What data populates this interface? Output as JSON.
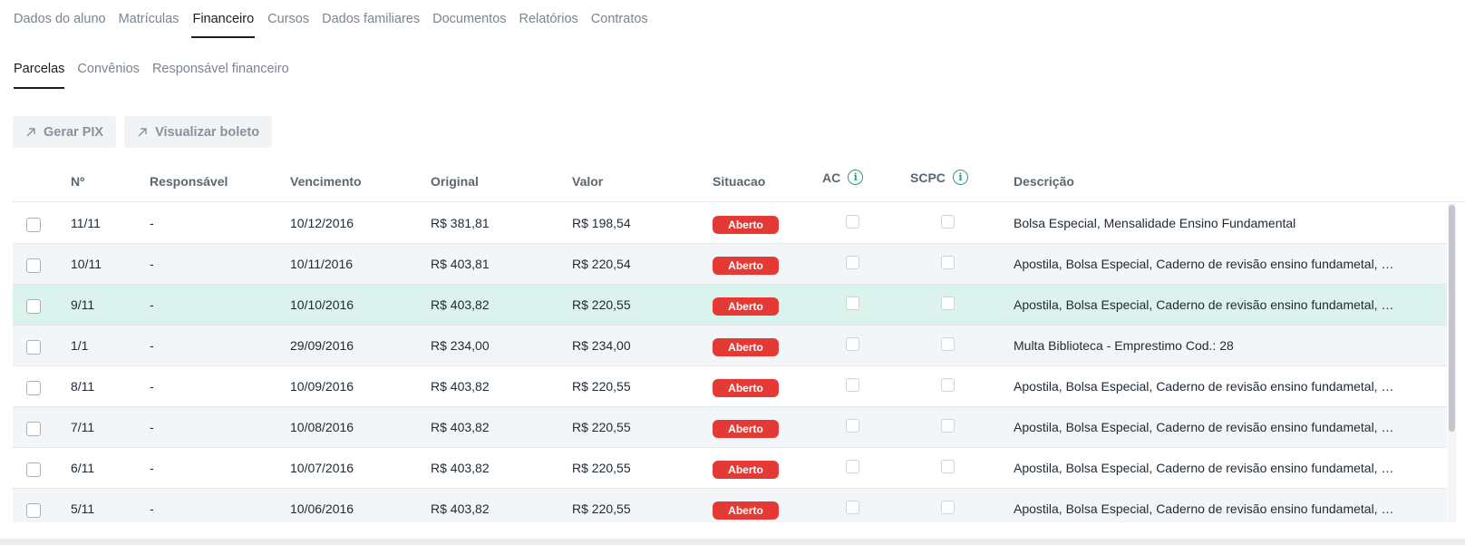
{
  "top_tabs": [
    {
      "label": "Dados do aluno"
    },
    {
      "label": "Matrículas"
    },
    {
      "label": "Financeiro",
      "active": true
    },
    {
      "label": "Cursos"
    },
    {
      "label": "Dados familiares"
    },
    {
      "label": "Documentos"
    },
    {
      "label": "Relatórios"
    },
    {
      "label": "Contratos"
    }
  ],
  "sub_tabs": [
    {
      "label": "Parcelas",
      "active": true
    },
    {
      "label": "Convênios"
    },
    {
      "label": "Responsável financeiro"
    }
  ],
  "actions": {
    "gerar_pix": "Gerar PIX",
    "visualizar_boleto": "Visualizar boleto",
    "icon": "arrow-up-right-icon"
  },
  "table": {
    "columns": {
      "numero": "Nº",
      "responsavel": "Responsável",
      "vencimento": "Vencimento",
      "original": "Original",
      "valor": "Valor",
      "situacao": "Situacao",
      "ac": "AC",
      "scpc": "SCPC",
      "descricao": "Descrição"
    },
    "rows": [
      {
        "numero": "11/11",
        "responsavel": "-",
        "vencimento": "10/12/2016",
        "original": "R$ 381,81",
        "valor": "R$ 198,54",
        "situacao": "Aberto",
        "descricao": "Bolsa Especial, Mensalidade Ensino Fundamental"
      },
      {
        "numero": "10/11",
        "responsavel": "-",
        "vencimento": "10/11/2016",
        "original": "R$ 403,81",
        "valor": "R$ 220,54",
        "situacao": "Aberto",
        "descricao": "Apostila, Bolsa Especial, Caderno de revisão ensino fundametal, Mensalidade Ensino Fundamental"
      },
      {
        "numero": "9/11",
        "responsavel": "-",
        "vencimento": "10/10/2016",
        "original": "R$ 403,82",
        "valor": "R$ 220,55",
        "situacao": "Aberto",
        "descricao": "Apostila, Bolsa Especial, Caderno de revisão ensino fundametal, Mensalidade Ensino Fundamental"
      },
      {
        "numero": "1/1",
        "responsavel": "-",
        "vencimento": "29/09/2016",
        "original": "R$ 234,00",
        "valor": "R$ 234,00",
        "situacao": "Aberto",
        "descricao": "Multa Biblioteca - Emprestimo Cod.: 28"
      },
      {
        "numero": "8/11",
        "responsavel": "-",
        "vencimento": "10/09/2016",
        "original": "R$ 403,82",
        "valor": "R$ 220,55",
        "situacao": "Aberto",
        "descricao": "Apostila, Bolsa Especial, Caderno de revisão ensino fundametal, Mensalidade Ensino Fundamental"
      },
      {
        "numero": "7/11",
        "responsavel": "-",
        "vencimento": "10/08/2016",
        "original": "R$ 403,82",
        "valor": "R$ 220,55",
        "situacao": "Aberto",
        "descricao": "Apostila, Bolsa Especial, Caderno de revisão ensino fundametal, Mensalidade Ensino Fundamental"
      },
      {
        "numero": "6/11",
        "responsavel": "-",
        "vencimento": "10/07/2016",
        "original": "R$ 403,82",
        "valor": "R$ 220,55",
        "situacao": "Aberto",
        "descricao": "Apostila, Bolsa Especial, Caderno de revisão ensino fundametal, Mensalidade Ensino Fundamental"
      },
      {
        "numero": "5/11",
        "responsavel": "-",
        "vencimento": "10/06/2016",
        "original": "R$ 403,82",
        "valor": "R$ 220,55",
        "situacao": "Aberto",
        "descricao": "Apostila, Bolsa Especial, Caderno de revisão ensino fundametal, Mensalidade Ensino Fundamental"
      }
    ],
    "highlighted_row": 2
  },
  "colors": {
    "accent": "#17a589",
    "badge_open": "#e53935",
    "row_highlight": "#dcf2ed",
    "row_alt": "#f3f6f9"
  }
}
